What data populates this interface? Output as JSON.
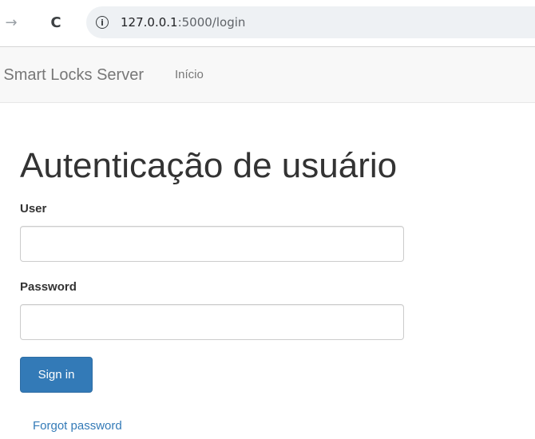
{
  "browser": {
    "forward_icon": "arrow-right-icon",
    "reload_icon": "reload-icon",
    "info_icon": "info-icon",
    "url_host": "127.0.0.1",
    "url_rest": ":5000/login"
  },
  "navbar": {
    "brand": "Smart Locks Server",
    "links": [
      {
        "label": "Início"
      }
    ]
  },
  "page": {
    "title": "Autenticação de usuário"
  },
  "form": {
    "user_label": "User",
    "user_value": "",
    "password_label": "Password",
    "password_value": "",
    "submit_label": "Sign in",
    "forgot_label": "Forgot password"
  },
  "colors": {
    "primary": "#337ab7",
    "navbar_bg": "#f8f8f8",
    "link": "#337ab7"
  }
}
